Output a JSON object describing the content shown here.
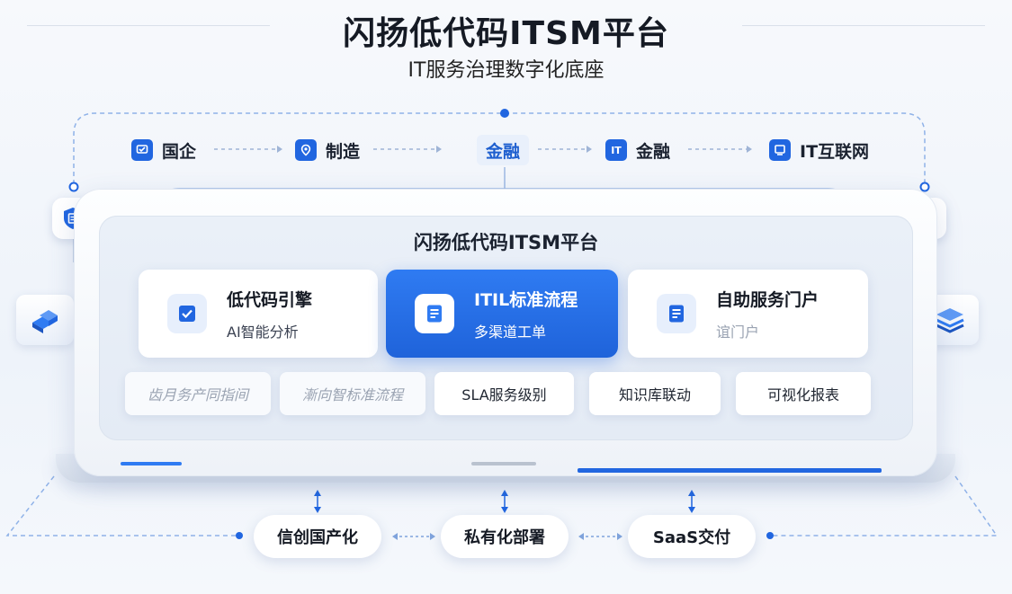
{
  "header": {
    "title": "闪扬低代码ITSM平台",
    "subtitle": "IT服务治理数字化底座"
  },
  "industries": [
    {
      "label": "国企",
      "icon": "certificate-icon"
    },
    {
      "label": "制造",
      "icon": "location-pin-icon"
    },
    {
      "label": "金融",
      "icon": null
    },
    {
      "label": "金融",
      "icon": "it-badge-icon",
      "icon_text": "IT"
    },
    {
      "label": "IT互联网",
      "icon": "monitor-icon"
    }
  ],
  "platform": {
    "title": "闪扬低代码ITSM平台",
    "cards": [
      {
        "title": "低代码引擎",
        "subtitle": "AI智能分析",
        "icon": "form-check-icon"
      },
      {
        "title": "ITIL标准流程",
        "subtitle": "多渠道工单",
        "icon": "document-icon"
      },
      {
        "title": "自助服务门户",
        "subtitle": "谊门户",
        "icon": "list-doc-icon"
      }
    ],
    "modules": [
      "齿月务产同指间",
      "漸向智标准流程",
      "SLA服务级别",
      "知识库联动",
      "可视化报表"
    ]
  },
  "deployment": [
    "信创国产化",
    "私有化部署",
    "SaaS交付"
  ],
  "side_icons": [
    "shield-doc-icon",
    "gear-icon",
    "building-blocks-icon",
    "layers-icon"
  ],
  "colors": {
    "accent": "#2166e0",
    "active_card": "#2f7bf2"
  }
}
